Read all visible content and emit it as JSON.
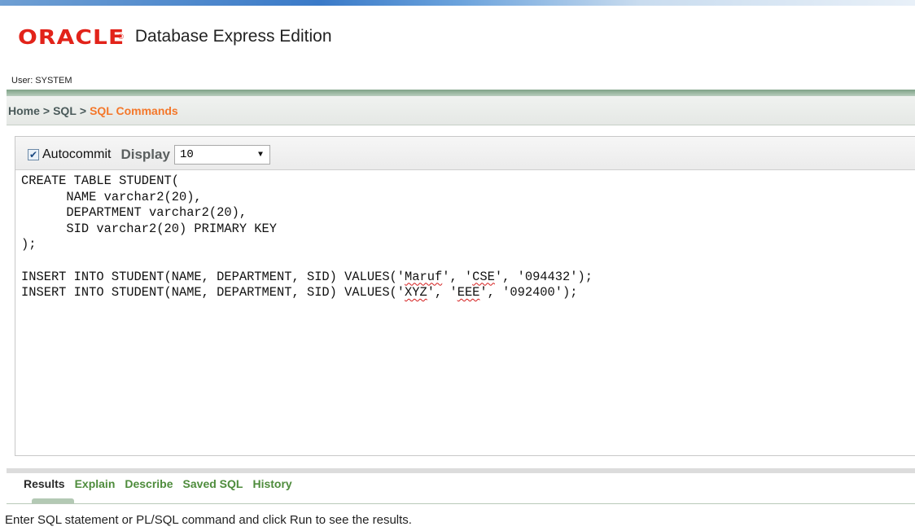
{
  "header": {
    "logo_text": "ORACLE",
    "logo_mark": "®",
    "product_title": "Database Express Edition",
    "user_label": "User:",
    "user_name": "SYSTEM"
  },
  "breadcrumb": {
    "items": [
      "Home",
      "SQL",
      "SQL Commands"
    ],
    "separator": ">"
  },
  "toolbar": {
    "autocommit_label": "Autocommit",
    "autocommit_checked": true,
    "display_label": "Display",
    "display_value": "10"
  },
  "editor": {
    "lines": [
      "CREATE TABLE STUDENT(",
      "      NAME varchar2(20),",
      "      DEPARTMENT varchar2(20),",
      "      SID varchar2(20) PRIMARY KEY",
      ");",
      "",
      "INSERT INTO STUDENT(NAME, DEPARTMENT, SID) VALUES('Maruf', 'CSE', '094432');",
      "INSERT INTO STUDENT(NAME, DEPARTMENT, SID) VALUES('XYZ', 'EEE', '092400');"
    ],
    "spellcheck_words": [
      "Maruf",
      "CSE",
      "XYZ",
      "EEE"
    ]
  },
  "results": {
    "tabs": [
      {
        "label": "Results",
        "active": true
      },
      {
        "label": "Explain",
        "active": false
      },
      {
        "label": "Describe",
        "active": false
      },
      {
        "label": "Saved SQL",
        "active": false
      },
      {
        "label": "History",
        "active": false
      }
    ],
    "message": "Enter SQL statement or PL/SQL command and click Run to see the results."
  },
  "colors": {
    "oracle_red": "#e2231a",
    "breadcrumb_current": "#f4772a",
    "tab_green": "#4e8c3c"
  }
}
